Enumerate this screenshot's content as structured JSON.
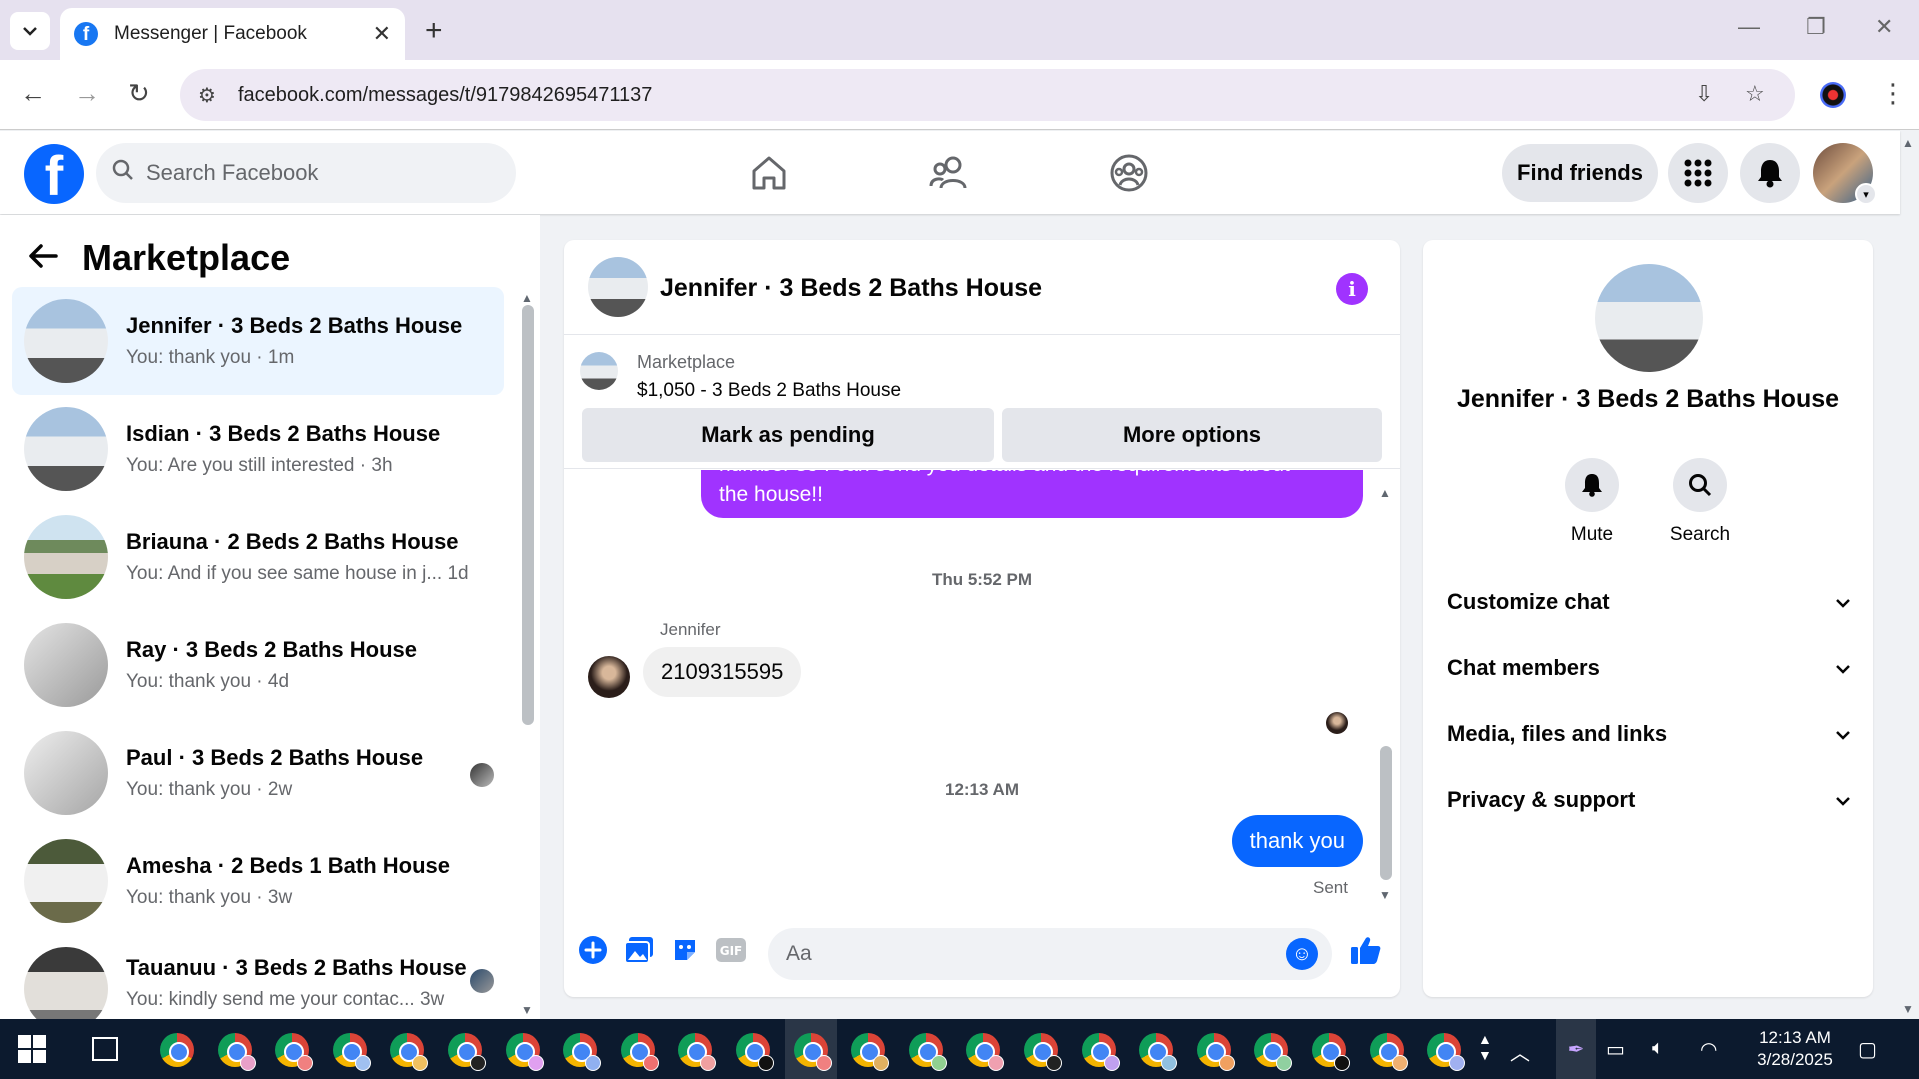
{
  "browser": {
    "tab_title": "Messenger | Facebook",
    "url": "facebook.com/messages/t/9179842695471137"
  },
  "fb": {
    "logo": "f",
    "search_placeholder": "Search Facebook",
    "find_friends": "Find friends"
  },
  "sidebar": {
    "title": "Marketplace",
    "conversations": [
      {
        "name": "Jennifer · 3 Beds 2 Baths House",
        "preview": "You: thank you · 1m"
      },
      {
        "name": "Isdian · 3 Beds 2 Baths House",
        "preview": "You: Are you still interested · 3h"
      },
      {
        "name": "Briauna · 2 Beds 2 Baths House",
        "preview": "You: And if you see same house in j...   1d"
      },
      {
        "name": "Ray · 3 Beds 2 Baths House",
        "preview": "You: thank you · 4d"
      },
      {
        "name": "Paul · 3 Beds 2 Baths House",
        "preview": "You: thank you · 2w"
      },
      {
        "name": "Amesha · 2 Beds 1 Bath House",
        "preview": "You: thank you · 3w"
      },
      {
        "name": "Tauanuu · 3 Beds 2 Baths House",
        "preview": "You: kindly send me your contac...   3w"
      }
    ]
  },
  "chat": {
    "title": "Jennifer · 3 Beds 2 Baths House",
    "marketplace_label": "Marketplace",
    "listing": "$1,050 - 3 Beds 2 Baths House",
    "mark_pending": "Mark as pending",
    "more_options": "More options",
    "msg_purple_line1": "number so I can send you details and the requirements about",
    "msg_purple_line2": "the house!!",
    "timestamp1": "Thu 5:52 PM",
    "sender": "Jennifer",
    "msg_received": "2109315595",
    "timestamp2": "12:13 AM",
    "msg_sent": "thank you",
    "sent_status": "Sent",
    "composer_placeholder": "Aa"
  },
  "info": {
    "name": "Jennifer · 3 Beds 2 Baths House",
    "mute": "Mute",
    "search": "Search",
    "sections": [
      "Customize chat",
      "Chat members",
      "Media, files and links",
      "Privacy & support"
    ]
  },
  "taskbar": {
    "time": "12:13 AM",
    "date": "3/28/2025"
  },
  "colors": {
    "fb_blue": "#0866ff",
    "purple": "#a033ff",
    "active_row": "#ebf5ff"
  }
}
